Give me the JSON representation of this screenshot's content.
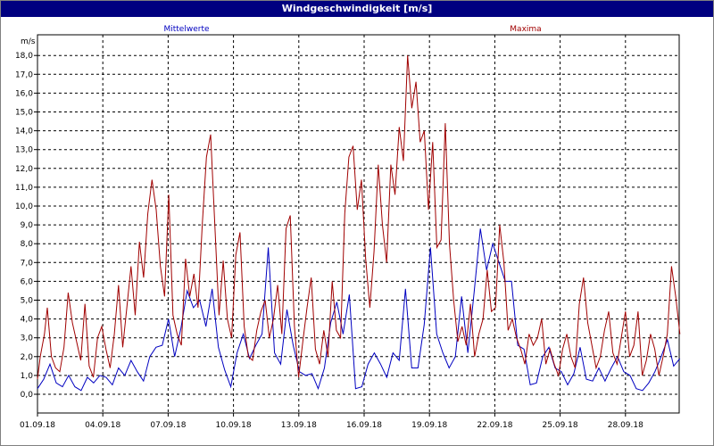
{
  "window": {
    "title": "Windgeschwindigkeit [m/s]"
  },
  "chart_data": {
    "type": "line",
    "title": "Windgeschwindigkeit [m/s]",
    "ylabel": "m/s",
    "xlabel": "",
    "ylim": [
      -1,
      19
    ],
    "x_ticks": [
      "01.09.18",
      "04.09.18",
      "07.09.18",
      "10.09.18",
      "13.09.18",
      "16.09.18",
      "19.09.18",
      "22.09.18",
      "25.09.18",
      "28.09.18"
    ],
    "y_ticks": [
      "0,0",
      "1,0",
      "2,0",
      "3,0",
      "4,0",
      "5,0",
      "6,0",
      "7,0",
      "8,0",
      "9,0",
      "10,0",
      "11,0",
      "12,0",
      "13,0",
      "14,0",
      "15,0",
      "16,0",
      "17,0",
      "18,0"
    ],
    "grid": true,
    "legend_position": "top",
    "x_unit": "day of month (September 2018)",
    "series": [
      {
        "name": "Mittelwerte",
        "color": "#0000c0",
        "points": [
          [
            1.0,
            0.3
          ],
          [
            1.3,
            0.8
          ],
          [
            1.6,
            1.6
          ],
          [
            1.9,
            0.6
          ],
          [
            2.2,
            0.4
          ],
          [
            2.5,
            1.0
          ],
          [
            2.8,
            0.4
          ],
          [
            3.1,
            0.2
          ],
          [
            3.4,
            0.9
          ],
          [
            3.7,
            0.6
          ],
          [
            4.0,
            1.0
          ],
          [
            4.3,
            0.9
          ],
          [
            4.6,
            0.5
          ],
          [
            4.9,
            1.4
          ],
          [
            5.2,
            1.0
          ],
          [
            5.5,
            1.8
          ],
          [
            5.8,
            1.2
          ],
          [
            6.1,
            0.7
          ],
          [
            6.4,
            2.0
          ],
          [
            6.7,
            2.5
          ],
          [
            7.0,
            2.6
          ],
          [
            7.3,
            4.0
          ],
          [
            7.6,
            2.0
          ],
          [
            7.9,
            3.5
          ],
          [
            8.2,
            5.5
          ],
          [
            8.5,
            4.6
          ],
          [
            8.8,
            5.0
          ],
          [
            9.1,
            3.6
          ],
          [
            9.4,
            5.6
          ],
          [
            9.7,
            2.5
          ],
          [
            10.0,
            1.3
          ],
          [
            10.3,
            0.4
          ],
          [
            10.6,
            2.2
          ],
          [
            10.9,
            3.2
          ],
          [
            11.2,
            1.9
          ],
          [
            11.5,
            2.6
          ],
          [
            11.8,
            3.2
          ],
          [
            12.1,
            7.8
          ],
          [
            12.4,
            2.2
          ],
          [
            12.7,
            1.6
          ],
          [
            13.0,
            4.5
          ],
          [
            13.3,
            2.6
          ],
          [
            13.6,
            1.2
          ],
          [
            13.9,
            1.0
          ],
          [
            14.2,
            1.1
          ],
          [
            14.5,
            0.3
          ],
          [
            14.8,
            1.4
          ],
          [
            15.1,
            3.8
          ],
          [
            15.4,
            4.9
          ],
          [
            15.7,
            3.2
          ],
          [
            16.0,
            5.3
          ],
          [
            16.3,
            0.3
          ],
          [
            16.6,
            0.4
          ],
          [
            16.9,
            1.6
          ],
          [
            17.2,
            2.2
          ],
          [
            17.5,
            1.6
          ],
          [
            17.8,
            0.9
          ],
          [
            18.1,
            2.2
          ],
          [
            18.4,
            1.8
          ],
          [
            18.7,
            5.6
          ],
          [
            19.0,
            1.4
          ],
          [
            19.3,
            1.4
          ],
          [
            19.6,
            3.7
          ],
          [
            19.9,
            7.8
          ],
          [
            20.2,
            3.2
          ],
          [
            20.5,
            2.2
          ],
          [
            20.8,
            1.4
          ],
          [
            21.1,
            2.0
          ],
          [
            21.4,
            5.2
          ],
          [
            21.7,
            2.2
          ],
          [
            22.0,
            5.4
          ],
          [
            22.3,
            8.8
          ],
          [
            22.6,
            6.6
          ],
          [
            22.9,
            8.0
          ],
          [
            23.2,
            7.0
          ],
          [
            23.5,
            6.0
          ],
          [
            23.8,
            6.0
          ],
          [
            24.1,
            2.6
          ],
          [
            24.4,
            2.4
          ],
          [
            24.7,
            0.5
          ],
          [
            25.0,
            0.6
          ],
          [
            25.3,
            2.0
          ],
          [
            25.6,
            2.5
          ],
          [
            25.9,
            1.4
          ],
          [
            26.2,
            1.2
          ],
          [
            26.5,
            0.5
          ],
          [
            26.8,
            1.1
          ],
          [
            27.1,
            2.5
          ],
          [
            27.4,
            0.8
          ],
          [
            27.7,
            0.7
          ],
          [
            28.0,
            1.4
          ],
          [
            28.3,
            0.7
          ],
          [
            28.6,
            1.4
          ],
          [
            28.9,
            2.0
          ],
          [
            29.2,
            1.2
          ],
          [
            29.5,
            1.0
          ],
          [
            29.8,
            0.3
          ],
          [
            30.1,
            0.2
          ],
          [
            30.4,
            0.6
          ],
          [
            30.7,
            1.2
          ],
          [
            31.0,
            2.0
          ],
          [
            31.3,
            2.9
          ],
          [
            31.6,
            1.5
          ],
          [
            31.9,
            1.9
          ]
        ]
      },
      {
        "name": "Maxima",
        "color": "#a00000",
        "points": [
          [
            1.0,
            0.8
          ],
          [
            1.2,
            2.0
          ],
          [
            1.5,
            3.2
          ],
          [
            1.7,
            4.6
          ],
          [
            2.0,
            2.0
          ],
          [
            2.3,
            1.4
          ],
          [
            2.6,
            1.2
          ],
          [
            2.9,
            2.5
          ],
          [
            3.2,
            5.4
          ],
          [
            3.5,
            3.8
          ],
          [
            3.8,
            2.8
          ],
          [
            4.1,
            1.8
          ],
          [
            4.4,
            4.8
          ],
          [
            4.7,
            1.5
          ],
          [
            5.0,
            0.9
          ],
          [
            5.3,
            3.0
          ],
          [
            5.6,
            3.6
          ],
          [
            5.9,
            2.4
          ],
          [
            6.2,
            1.4
          ],
          [
            6.5,
            3.2
          ],
          [
            6.8,
            5.8
          ],
          [
            7.1,
            2.5
          ],
          [
            7.4,
            4.6
          ],
          [
            7.7,
            6.8
          ],
          [
            8.0,
            4.2
          ],
          [
            8.3,
            8.1
          ],
          [
            8.6,
            6.2
          ],
          [
            8.9,
            9.6
          ],
          [
            9.2,
            11.4
          ],
          [
            9.5,
            9.8
          ],
          [
            9.8,
            6.8
          ],
          [
            10.1,
            5.2
          ],
          [
            10.4,
            10.6
          ],
          [
            10.7,
            4.2
          ],
          [
            11.0,
            3.2
          ],
          [
            11.3,
            2.6
          ],
          [
            11.6,
            7.2
          ],
          [
            11.9,
            5.2
          ],
          [
            12.2,
            6.4
          ],
          [
            12.5,
            4.6
          ],
          [
            12.8,
            9.0
          ],
          [
            13.1,
            12.6
          ],
          [
            13.4,
            13.8
          ],
          [
            13.7,
            9.0
          ],
          [
            14.0,
            4.2
          ],
          [
            14.3,
            7.1
          ],
          [
            14.6,
            4.0
          ],
          [
            14.9,
            3.0
          ],
          [
            15.2,
            7.4
          ],
          [
            15.5,
            8.6
          ],
          [
            15.8,
            3.6
          ],
          [
            16.1,
            2.0
          ],
          [
            16.4,
            1.8
          ],
          [
            16.7,
            3.4
          ],
          [
            17.0,
            4.4
          ],
          [
            17.3,
            5.0
          ],
          [
            17.6,
            3.0
          ],
          [
            17.9,
            4.0
          ],
          [
            18.2,
            5.8
          ],
          [
            18.5,
            3.2
          ],
          [
            18.8,
            8.8
          ],
          [
            19.1,
            9.5
          ],
          [
            19.4,
            3.6
          ],
          [
            19.7,
            0.9
          ],
          [
            20.0,
            2.8
          ],
          [
            20.3,
            4.6
          ],
          [
            20.6,
            6.2
          ],
          [
            20.9,
            2.4
          ],
          [
            21.2,
            1.6
          ],
          [
            21.5,
            3.4
          ],
          [
            21.8,
            2.0
          ],
          [
            22.1,
            6.0
          ],
          [
            22.4,
            3.4
          ],
          [
            22.7,
            3.0
          ],
          [
            23.0,
            9.6
          ],
          [
            23.3,
            12.6
          ],
          [
            23.6,
            13.2
          ],
          [
            23.9,
            9.8
          ],
          [
            24.2,
            11.4
          ],
          [
            24.5,
            7.2
          ],
          [
            24.8,
            4.6
          ],
          [
            25.1,
            7.6
          ],
          [
            25.4,
            12.2
          ],
          [
            25.7,
            9.0
          ],
          [
            26.0,
            7.0
          ],
          [
            26.3,
            12.2
          ],
          [
            26.6,
            10.6
          ],
          [
            26.9,
            14.2
          ],
          [
            27.2,
            12.4
          ],
          [
            27.5,
            18.0
          ],
          [
            27.8,
            15.2
          ],
          [
            28.1,
            16.6
          ],
          [
            28.4,
            13.4
          ],
          [
            28.7,
            14.0
          ],
          [
            29.0,
            9.8
          ],
          [
            29.3,
            13.4
          ],
          [
            29.6,
            7.8
          ],
          [
            29.9,
            8.2
          ],
          [
            30.2,
            14.4
          ],
          [
            30.5,
            8.0
          ],
          [
            30.8,
            5.0
          ],
          [
            31.1,
            2.8
          ],
          [
            31.4,
            3.6
          ],
          [
            31.7,
            2.6
          ],
          [
            32.0,
            4.8
          ],
          [
            32.3,
            2.0
          ],
          [
            32.6,
            3.2
          ],
          [
            32.9,
            4.0
          ],
          [
            33.2,
            6.6
          ],
          [
            33.5,
            4.4
          ],
          [
            33.8,
            4.6
          ],
          [
            34.1,
            9.0
          ],
          [
            34.4,
            7.0
          ],
          [
            34.7,
            3.4
          ],
          [
            35.0,
            4.0
          ],
          [
            35.3,
            3.0
          ],
          [
            35.6,
            2.4
          ],
          [
            35.9,
            1.6
          ],
          [
            36.2,
            3.2
          ],
          [
            36.5,
            2.6
          ],
          [
            36.8,
            3.0
          ],
          [
            37.1,
            4.0
          ],
          [
            37.4,
            1.6
          ],
          [
            37.7,
            2.4
          ],
          [
            38.0,
            1.6
          ],
          [
            38.3,
            1.0
          ],
          [
            38.6,
            2.4
          ],
          [
            38.9,
            3.2
          ],
          [
            39.2,
            2.0
          ],
          [
            39.5,
            1.4
          ],
          [
            39.8,
            4.8
          ],
          [
            40.1,
            6.2
          ],
          [
            40.4,
            3.8
          ],
          [
            40.7,
            2.6
          ],
          [
            41.0,
            1.4
          ],
          [
            41.3,
            2.0
          ],
          [
            41.6,
            3.4
          ],
          [
            41.9,
            4.4
          ],
          [
            42.2,
            2.2
          ],
          [
            42.5,
            1.6
          ],
          [
            42.8,
            3.0
          ],
          [
            43.1,
            4.4
          ],
          [
            43.4,
            2.0
          ],
          [
            43.7,
            2.6
          ],
          [
            44.0,
            4.4
          ],
          [
            44.3,
            1.0
          ],
          [
            44.6,
            1.8
          ],
          [
            44.9,
            3.2
          ],
          [
            45.2,
            2.4
          ],
          [
            45.5,
            1.0
          ],
          [
            45.8,
            2.0
          ],
          [
            46.1,
            3.2
          ],
          [
            46.4,
            6.8
          ],
          [
            46.7,
            5.2
          ],
          [
            47.0,
            3.2
          ]
        ]
      }
    ]
  }
}
